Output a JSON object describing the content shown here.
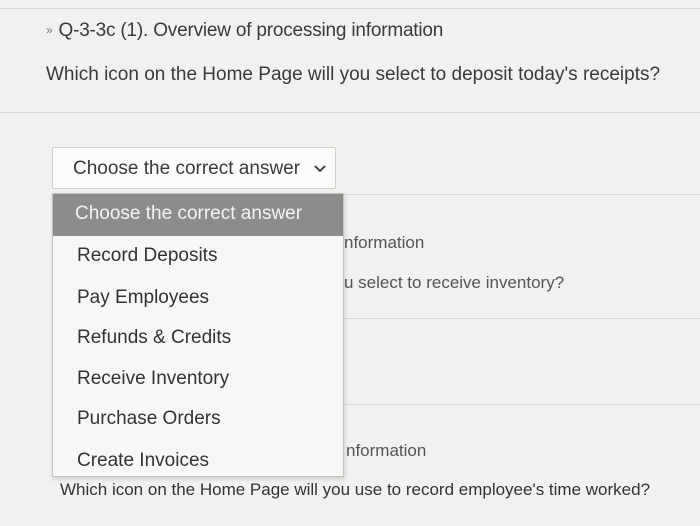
{
  "question1": {
    "bullet": "»",
    "title": "Q-3-3c (1). Overview of processing information",
    "text": "Which icon on the Home Page will you select to deposit today's receipts?"
  },
  "select": {
    "placeholder": "Choose the correct answer",
    "options": [
      "Choose the correct answer",
      "Record Deposits",
      "Pay Employees",
      "Refunds & Credits",
      "Receive Inventory",
      "Purchase Orders",
      "Create Invoices"
    ]
  },
  "background": {
    "q2_title_fragment": "nformation",
    "q2_text_fragment": "u select to receive inventory?",
    "q3_title_fragment": "nformation",
    "q3_text": "Which icon on the Home Page will you use to record employee's time worked?"
  }
}
